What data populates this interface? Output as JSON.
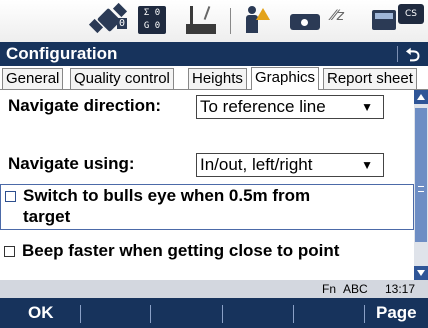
{
  "statusbar": {
    "satellites_count": "0",
    "counts_top": "Σ 0",
    "counts_bottom": "G 0",
    "hz_label": "⁄⁄z",
    "cs_label": "CS",
    "icons": [
      "satellite-icon",
      "satellite-counts-icon",
      "base-station-icon",
      "person-warning-icon",
      "camera-icon",
      "hz-icon",
      "battery-icon",
      "cs-icon"
    ]
  },
  "titlebar": {
    "title": "Configuration",
    "back_glyph": "⮌"
  },
  "tabs": [
    {
      "label": "General",
      "active": false
    },
    {
      "label": "Quality control",
      "active": false
    },
    {
      "label": "Heights",
      "active": false
    },
    {
      "label": "Graphics",
      "active": true
    },
    {
      "label": "Report sheet",
      "active": false
    }
  ],
  "form": {
    "navigate_direction_label": "Navigate direction:",
    "navigate_direction_value": "To reference line",
    "navigate_using_label": "Navigate using:",
    "navigate_using_value": "In/out, left/right",
    "bulls_eye_line1": "Switch to bulls eye when 0.5m from",
    "bulls_eye_line2": "target",
    "beep_label": "Beep faster when getting close to point",
    "dropdown_arrow": "▼"
  },
  "infobar": {
    "fn": "Fn",
    "abc": "ABC",
    "time": "13:17"
  },
  "softkeys": {
    "ok": "OK",
    "page": "Page"
  },
  "colors": {
    "title_bg": "#17335c",
    "accent": "#2f5597",
    "info_bg": "#d3d7df"
  }
}
